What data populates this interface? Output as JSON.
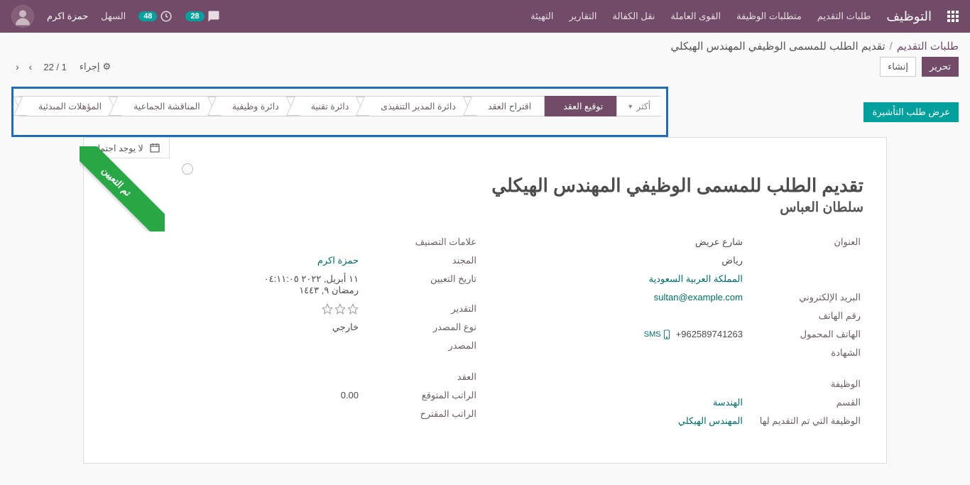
{
  "topnav": {
    "brand": "التوظيف",
    "links": [
      "طلبات التقديم",
      "متطلبات الوظيفة",
      "القوى العاملة",
      "نقل الكفالة",
      "التقارير",
      "التهيئة"
    ],
    "chat_badge": "28",
    "activity_badge": "48",
    "easy": "السهل",
    "username": "حمزة اكرم"
  },
  "breadcrumb": {
    "root": "طلبات التقديم",
    "current": "تقديم الطلب للمسمى الوظيفي المهندس الهيكلي"
  },
  "controls": {
    "edit": "تحرير",
    "create": "إنشاء",
    "action": "إجراء",
    "pager": "1 / 22"
  },
  "visa_button": "عرض طلب التأشيرة",
  "stages": {
    "more": "أكثر",
    "items": [
      "المؤهلات المبدئية",
      "المناقشة الجماعية",
      "دائرة وظيفية",
      "دائرة تقنية",
      "دائرة المدير التنفيذى",
      "اقتراح العقد",
      "توقيع العقد"
    ],
    "active_index": 6
  },
  "meeting_tab": "لا يوجد اجتماع",
  "ribbon": "تم التعيين",
  "form": {
    "title": "تقديم الطلب للمسمى الوظيفي المهندس الهيكلي",
    "subtitle": "سلطان العباس",
    "labels": {
      "address": "العنوان",
      "email": "البريد الإلكتروني",
      "phone": "رقم الهاتف",
      "mobile": "الهاتف المحمول",
      "degree": "الشهادة",
      "job": "الوظيفة",
      "dept": "القسم",
      "applied_job": "الوظيفة التي تم التقديم لها",
      "tags": "علامات التصنيف",
      "recruiter": "المجند",
      "hire_date": "تاريخ التعيين",
      "rating": "التقدير",
      "source_type": "نوع المصدر",
      "source": "المصدر",
      "contract": "العقد",
      "expected": "الراتب المتوقع",
      "proposed": "الراتب المقترح"
    },
    "address": {
      "street": "شارع عريض",
      "city": "رياض",
      "country": "المملكة العربية السعودية"
    },
    "email": "sultan@example.com",
    "mobile": "+962589741263",
    "sms": "SMS",
    "dept": "الهندسة",
    "applied_job": "المهندس الهيكلي",
    "recruiter": "حمزة اكرم",
    "hire_date_greg": "١١ أبريل, ٢٠٢٢ ٠٤:١١:٠٥",
    "hire_date_hijri": "رمضان ٩, ١٤٤٣",
    "source_type": "خارجي",
    "expected": "0.00"
  }
}
